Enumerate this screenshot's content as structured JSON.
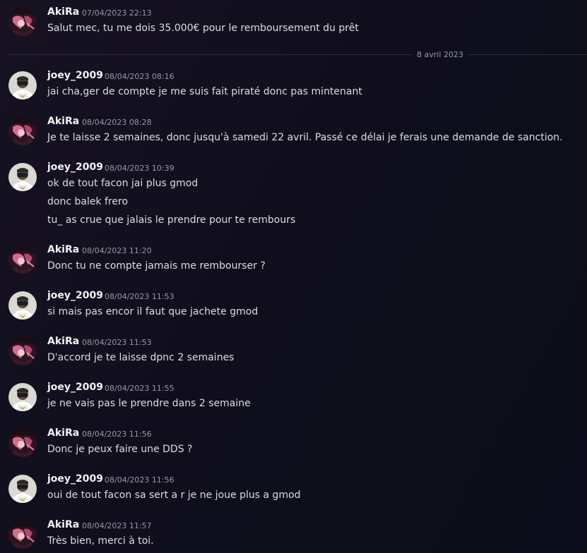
{
  "date_divider": "8 avril 2023",
  "messages": [
    {
      "author": "AkiRa",
      "time": "07/04/2023 22:13",
      "avatar_icon": "akira-avatar",
      "lines": [
        "Salut mec, tu me dois 35.000€ pour le remboursement du prêt"
      ]
    },
    {
      "author": "joey_2009",
      "time": "08/04/2023 08:16",
      "avatar_icon": "joey-avatar",
      "lines": [
        "jai cha,ger de compte je me suis fait piraté donc pas mintenant"
      ]
    },
    {
      "author": "AkiRa",
      "time": "08/04/2023 08:28",
      "avatar_icon": "akira-avatar",
      "lines": [
        "Je te laisse 2 semaines, donc jusqu'à samedi 22 avril. Passé ce délai je ferais une demande de sanction."
      ]
    },
    {
      "author": "joey_2009",
      "time": "08/04/2023 10:39",
      "avatar_icon": "joey-avatar",
      "lines": [
        "ok de tout facon jai plus gmod",
        "donc balek frero",
        "tu_ as crue que jalais le prendre pour te rembours"
      ]
    },
    {
      "author": "AkiRa",
      "time": "08/04/2023 11:20",
      "avatar_icon": "akira-avatar",
      "lines": [
        "Donc tu ne compte jamais me rembourser ?"
      ]
    },
    {
      "author": "joey_2009",
      "time": "08/04/2023 11:53",
      "avatar_icon": "joey-avatar",
      "lines": [
        "si mais pas encor il faut que jachete gmod"
      ]
    },
    {
      "author": "AkiRa",
      "time": "08/04/2023 11:53",
      "avatar_icon": "akira-avatar",
      "lines": [
        "D'accord je te laisse dpnc 2 semaines"
      ]
    },
    {
      "author": "joey_2009",
      "time": "08/04/2023 11:55",
      "avatar_icon": "joey-avatar",
      "lines": [
        "je ne vais pas le prendre dans 2 semaine"
      ]
    },
    {
      "author": "AkiRa",
      "time": "08/04/2023 11:56",
      "avatar_icon": "akira-avatar",
      "lines": [
        "Donc je peux faire une DDS ?"
      ]
    },
    {
      "author": "joey_2009",
      "time": "08/04/2023 11:56",
      "avatar_icon": "joey-avatar",
      "lines": [
        "oui de tout facon sa sert a r je ne joue plus a gmod"
      ]
    },
    {
      "author": "AkiRa",
      "time": "08/04/2023 11:57",
      "avatar_icon": "akira-avatar",
      "lines": [
        "Très bien, merci à toi."
      ]
    }
  ]
}
